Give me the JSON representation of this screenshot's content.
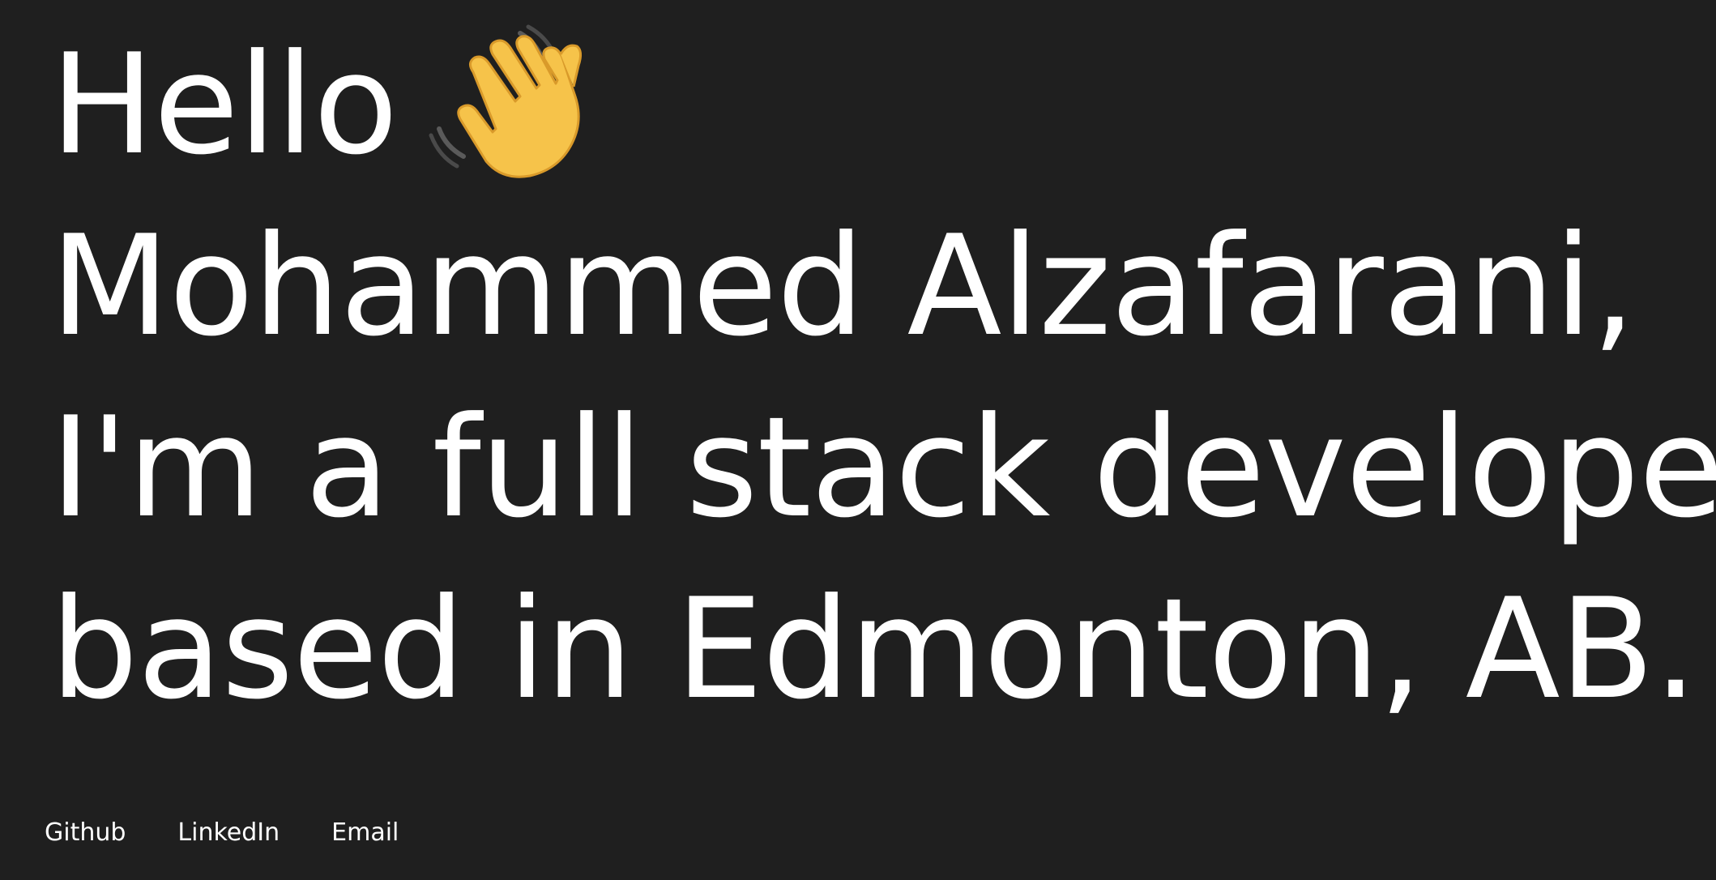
{
  "hero": {
    "greeting": "Hello",
    "wave_icon": "waving-hand-icon",
    "line2": "Mohammed Alzafarani,",
    "line3": "I'm a full stack developer",
    "line4": "based in Edmonton, AB."
  },
  "links": [
    {
      "label": "Github"
    },
    {
      "label": "LinkedIn"
    },
    {
      "label": "Email"
    }
  ],
  "colors": {
    "background": "#1f1f1f",
    "text": "#ffffff",
    "wave_skin": "#f6c34a"
  }
}
